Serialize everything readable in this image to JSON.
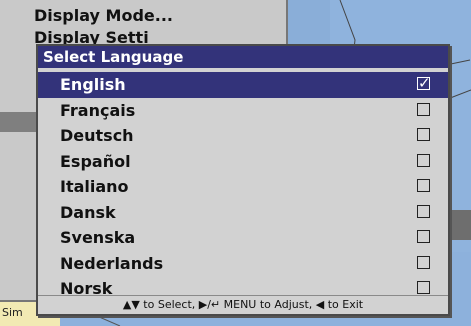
{
  "background_menu": {
    "items": [
      "Display Mode...",
      "Display Setti",
      "",
      "",
      "",
      "",
      "",
      ""
    ]
  },
  "status": {
    "text": "Sim"
  },
  "dialog": {
    "title": "Select Language",
    "languages": [
      {
        "label": "English",
        "checked": true
      },
      {
        "label": "Français",
        "checked": false
      },
      {
        "label": "Deutsch",
        "checked": false
      },
      {
        "label": "Español",
        "checked": false
      },
      {
        "label": "Italiano",
        "checked": false
      },
      {
        "label": "Dansk",
        "checked": false
      },
      {
        "label": "Svenska",
        "checked": false
      },
      {
        "label": "Nederlands",
        "checked": false
      },
      {
        "label": "Norsk",
        "checked": false
      }
    ],
    "footer": "▲▼ to Select, ▶/↵ MENU to Adjust, ◀ to Exit"
  },
  "colors": {
    "title_bar": "#33337a",
    "selection": "#33337a",
    "dialog_bg": "#d2d2d2"
  }
}
